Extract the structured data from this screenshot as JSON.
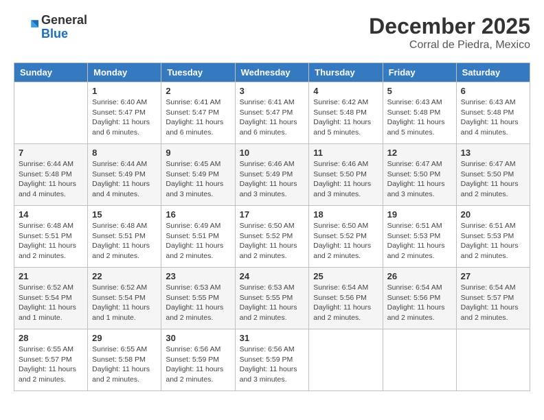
{
  "header": {
    "logo": {
      "general": "General",
      "blue": "Blue"
    },
    "title": "December 2025",
    "location": "Corral de Piedra, Mexico"
  },
  "days_of_week": [
    "Sunday",
    "Monday",
    "Tuesday",
    "Wednesday",
    "Thursday",
    "Friday",
    "Saturday"
  ],
  "weeks": [
    [
      {
        "day": "",
        "info": ""
      },
      {
        "day": "1",
        "info": "Sunrise: 6:40 AM\nSunset: 5:47 PM\nDaylight: 11 hours\nand 6 minutes."
      },
      {
        "day": "2",
        "info": "Sunrise: 6:41 AM\nSunset: 5:47 PM\nDaylight: 11 hours\nand 6 minutes."
      },
      {
        "day": "3",
        "info": "Sunrise: 6:41 AM\nSunset: 5:47 PM\nDaylight: 11 hours\nand 6 minutes."
      },
      {
        "day": "4",
        "info": "Sunrise: 6:42 AM\nSunset: 5:48 PM\nDaylight: 11 hours\nand 5 minutes."
      },
      {
        "day": "5",
        "info": "Sunrise: 6:43 AM\nSunset: 5:48 PM\nDaylight: 11 hours\nand 5 minutes."
      },
      {
        "day": "6",
        "info": "Sunrise: 6:43 AM\nSunset: 5:48 PM\nDaylight: 11 hours\nand 4 minutes."
      }
    ],
    [
      {
        "day": "7",
        "info": "Sunrise: 6:44 AM\nSunset: 5:48 PM\nDaylight: 11 hours\nand 4 minutes."
      },
      {
        "day": "8",
        "info": "Sunrise: 6:44 AM\nSunset: 5:49 PM\nDaylight: 11 hours\nand 4 minutes."
      },
      {
        "day": "9",
        "info": "Sunrise: 6:45 AM\nSunset: 5:49 PM\nDaylight: 11 hours\nand 3 minutes."
      },
      {
        "day": "10",
        "info": "Sunrise: 6:46 AM\nSunset: 5:49 PM\nDaylight: 11 hours\nand 3 minutes."
      },
      {
        "day": "11",
        "info": "Sunrise: 6:46 AM\nSunset: 5:50 PM\nDaylight: 11 hours\nand 3 minutes."
      },
      {
        "day": "12",
        "info": "Sunrise: 6:47 AM\nSunset: 5:50 PM\nDaylight: 11 hours\nand 3 minutes."
      },
      {
        "day": "13",
        "info": "Sunrise: 6:47 AM\nSunset: 5:50 PM\nDaylight: 11 hours\nand 2 minutes."
      }
    ],
    [
      {
        "day": "14",
        "info": "Sunrise: 6:48 AM\nSunset: 5:51 PM\nDaylight: 11 hours\nand 2 minutes."
      },
      {
        "day": "15",
        "info": "Sunrise: 6:48 AM\nSunset: 5:51 PM\nDaylight: 11 hours\nand 2 minutes."
      },
      {
        "day": "16",
        "info": "Sunrise: 6:49 AM\nSunset: 5:51 PM\nDaylight: 11 hours\nand 2 minutes."
      },
      {
        "day": "17",
        "info": "Sunrise: 6:50 AM\nSunset: 5:52 PM\nDaylight: 11 hours\nand 2 minutes."
      },
      {
        "day": "18",
        "info": "Sunrise: 6:50 AM\nSunset: 5:52 PM\nDaylight: 11 hours\nand 2 minutes."
      },
      {
        "day": "19",
        "info": "Sunrise: 6:51 AM\nSunset: 5:53 PM\nDaylight: 11 hours\nand 2 minutes."
      },
      {
        "day": "20",
        "info": "Sunrise: 6:51 AM\nSunset: 5:53 PM\nDaylight: 11 hours\nand 2 minutes."
      }
    ],
    [
      {
        "day": "21",
        "info": "Sunrise: 6:52 AM\nSunset: 5:54 PM\nDaylight: 11 hours\nand 1 minute."
      },
      {
        "day": "22",
        "info": "Sunrise: 6:52 AM\nSunset: 5:54 PM\nDaylight: 11 hours\nand 1 minute."
      },
      {
        "day": "23",
        "info": "Sunrise: 6:53 AM\nSunset: 5:55 PM\nDaylight: 11 hours\nand 2 minutes."
      },
      {
        "day": "24",
        "info": "Sunrise: 6:53 AM\nSunset: 5:55 PM\nDaylight: 11 hours\nand 2 minutes."
      },
      {
        "day": "25",
        "info": "Sunrise: 6:54 AM\nSunset: 5:56 PM\nDaylight: 11 hours\nand 2 minutes."
      },
      {
        "day": "26",
        "info": "Sunrise: 6:54 AM\nSunset: 5:56 PM\nDaylight: 11 hours\nand 2 minutes."
      },
      {
        "day": "27",
        "info": "Sunrise: 6:54 AM\nSunset: 5:57 PM\nDaylight: 11 hours\nand 2 minutes."
      }
    ],
    [
      {
        "day": "28",
        "info": "Sunrise: 6:55 AM\nSunset: 5:57 PM\nDaylight: 11 hours\nand 2 minutes."
      },
      {
        "day": "29",
        "info": "Sunrise: 6:55 AM\nSunset: 5:58 PM\nDaylight: 11 hours\nand 2 minutes."
      },
      {
        "day": "30",
        "info": "Sunrise: 6:56 AM\nSunset: 5:59 PM\nDaylight: 11 hours\nand 2 minutes."
      },
      {
        "day": "31",
        "info": "Sunrise: 6:56 AM\nSunset: 5:59 PM\nDaylight: 11 hours\nand 3 minutes."
      },
      {
        "day": "",
        "info": ""
      },
      {
        "day": "",
        "info": ""
      },
      {
        "day": "",
        "info": ""
      }
    ]
  ]
}
